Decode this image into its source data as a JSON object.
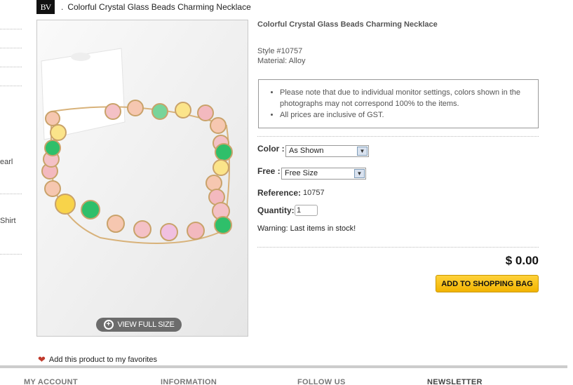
{
  "header": {
    "logo_text": "BV",
    "separator": ".",
    "breadcrumb_title": "Colorful Crystal Glass Beads Charming Necklace"
  },
  "sidebar": {
    "fragments": [
      "earl",
      "Shirt"
    ]
  },
  "product": {
    "title": "Colorful Crystal Glass Beads Charming Necklace",
    "style": "Style #10757",
    "material": "Material: Alloy",
    "notes": [
      "Please note that due to individual monitor settings, colors shown in the photographs may not correspond 100% to the items.",
      "All prices are inclusive of GST."
    ],
    "view_full_label": "VIEW FULL SIZE",
    "favorites_label": "Add this product to my favorites"
  },
  "options": {
    "color_label": "Color :",
    "color_value": "As Shown",
    "free_label": "Free :",
    "free_value": "Free Size"
  },
  "reference": {
    "label": "Reference:",
    "value": "10757"
  },
  "quantity": {
    "label": "Quantity:",
    "value": "1"
  },
  "warning": "Warning: Last items in stock!",
  "price": "$ 0.00",
  "add_button_label": "ADD TO SHOPPING BAG",
  "footer": {
    "items": [
      "MY ACCOUNT",
      "INFORMATION",
      "FOLLOW US",
      "NEWSLETTER"
    ]
  },
  "colors": {
    "button_yellow": "#f2b400",
    "zoom_pill": "#6c6c6c"
  }
}
